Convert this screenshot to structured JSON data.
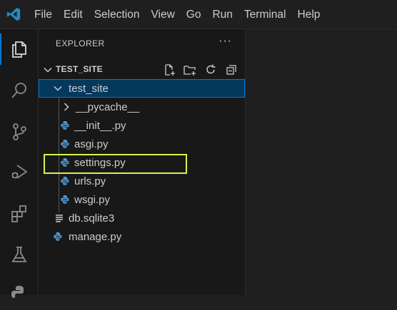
{
  "menu": {
    "items": [
      "File",
      "Edit",
      "Selection",
      "View",
      "Go",
      "Run",
      "Terminal",
      "Help"
    ]
  },
  "activity_bar": {
    "icons": [
      "explorer-icon",
      "search-icon",
      "source-control-icon",
      "run-debug-icon",
      "extensions-icon",
      "testing-icon",
      "python-icon"
    ]
  },
  "explorer": {
    "title": "EXPLORER",
    "more_actions": "···",
    "workspace": "TEST_SITE",
    "actions": [
      "new-file-icon",
      "new-folder-icon",
      "refresh-icon",
      "collapse-all-icon"
    ],
    "tree": [
      {
        "label": "test_site",
        "type": "folder-open",
        "depth": 1
      },
      {
        "label": "__pycache__",
        "type": "folder-closed",
        "depth": 2
      },
      {
        "label": "__init__.py",
        "type": "python",
        "depth": 2
      },
      {
        "label": "asgi.py",
        "type": "python",
        "depth": 2
      },
      {
        "label": "settings.py",
        "type": "python",
        "depth": 2
      },
      {
        "label": "urls.py",
        "type": "python",
        "depth": 2
      },
      {
        "label": "wsgi.py",
        "type": "python",
        "depth": 2
      },
      {
        "label": "db.sqlite3",
        "type": "text",
        "depth": 1
      },
      {
        "label": "manage.py",
        "type": "python",
        "depth": 1
      }
    ]
  },
  "colors": {
    "accent": "#0078d4",
    "selection": "#04395e",
    "highlight": "#d4f54a",
    "python_icon": "#4f9ad6",
    "vscode_logo": "#2489ca"
  }
}
